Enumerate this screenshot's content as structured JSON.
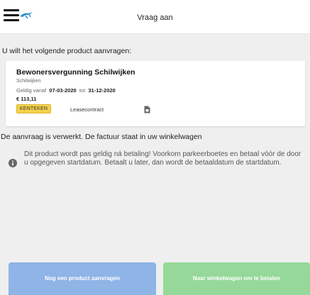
{
  "header": {
    "title": "Vraag aan"
  },
  "intro_text": "U wilt het volgende product aanvragen:",
  "product": {
    "name": "Bewonersvergunning Schilwijken",
    "area": "Schilwijken",
    "valid_from_label": "Geldig vanaf",
    "valid_from": "07-03-2020",
    "valid_to_label": "tot",
    "valid_to": "31-12-2020",
    "price": "€ 113,11",
    "badge": "KENTEKEN",
    "lease_label": "Leasecontract"
  },
  "processed_text": "De aanvraag is verwerkt. De factuur staat in uw winkelwagen",
  "info_text": "Dit product wordt pas geldig ná betaling! Voorkom parkeerboetes en betaal vóór de door u opgegeven startdatum. Betaalt u later, dan wordt de betaaldatum de startdatum.",
  "buttons": {
    "new_product": "Nog een product aanvragen",
    "to_cart": "Naar winkelwagen om te betalen"
  },
  "colors": {
    "button_blue": "#8fb4e6",
    "button_green": "#96d89a",
    "badge_yellow": "#f5d24a",
    "background": "#efefef"
  },
  "icons": [
    "menu-icon",
    "logo-icon",
    "document-icon",
    "info-icon"
  ]
}
